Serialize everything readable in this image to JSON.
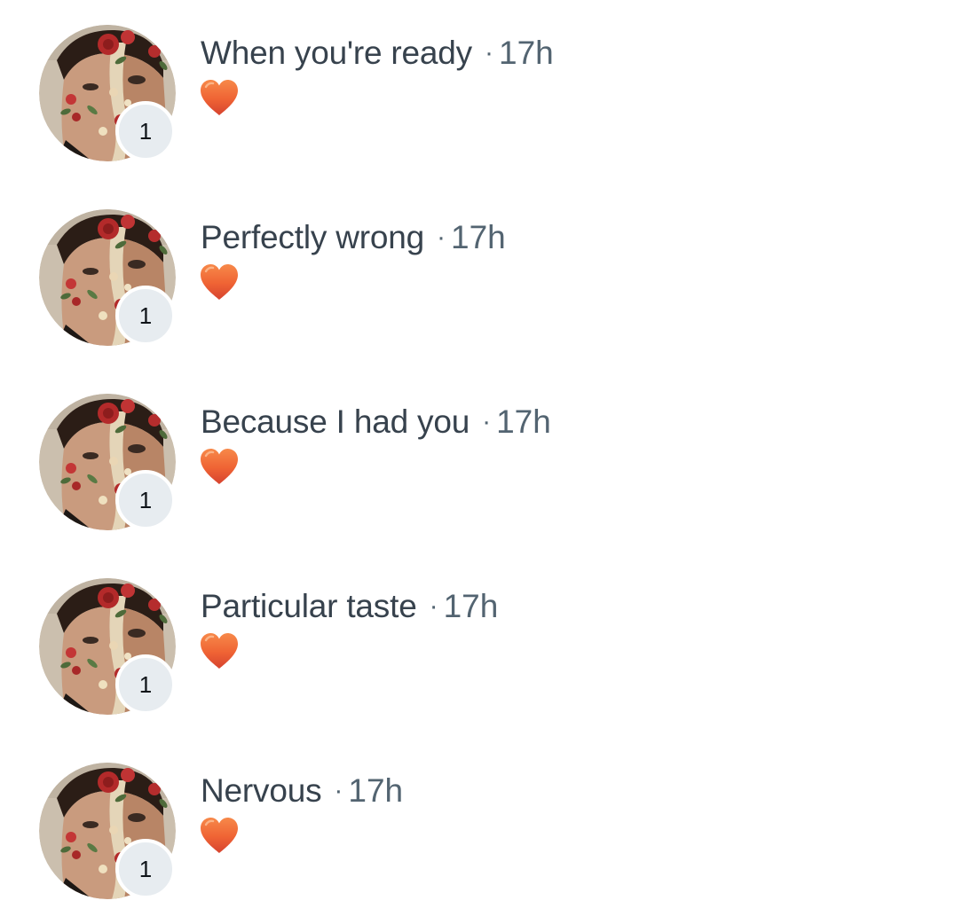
{
  "colors": {
    "badge_bg": "#e7ecf0",
    "name_text": "#37424d",
    "secondary_text": "#536471",
    "heart_top": "#f4793a",
    "heart_bottom": "#d6432f"
  },
  "items": [
    {
      "name": "When you're ready",
      "separator": "·",
      "time": "17h",
      "count": "1",
      "reaction_icon": "orange-heart-icon"
    },
    {
      "name": "Perfectly wrong",
      "separator": "·",
      "time": "17h",
      "count": "1",
      "reaction_icon": "orange-heart-icon"
    },
    {
      "name": "Because I had you",
      "separator": "·",
      "time": "17h",
      "count": "1",
      "reaction_icon": "orange-heart-icon"
    },
    {
      "name": "Particular taste",
      "separator": "·",
      "time": "17h",
      "count": "1",
      "reaction_icon": "orange-heart-icon"
    },
    {
      "name": "Nervous",
      "separator": "·",
      "time": "17h",
      "count": "1",
      "reaction_icon": "orange-heart-icon"
    }
  ]
}
